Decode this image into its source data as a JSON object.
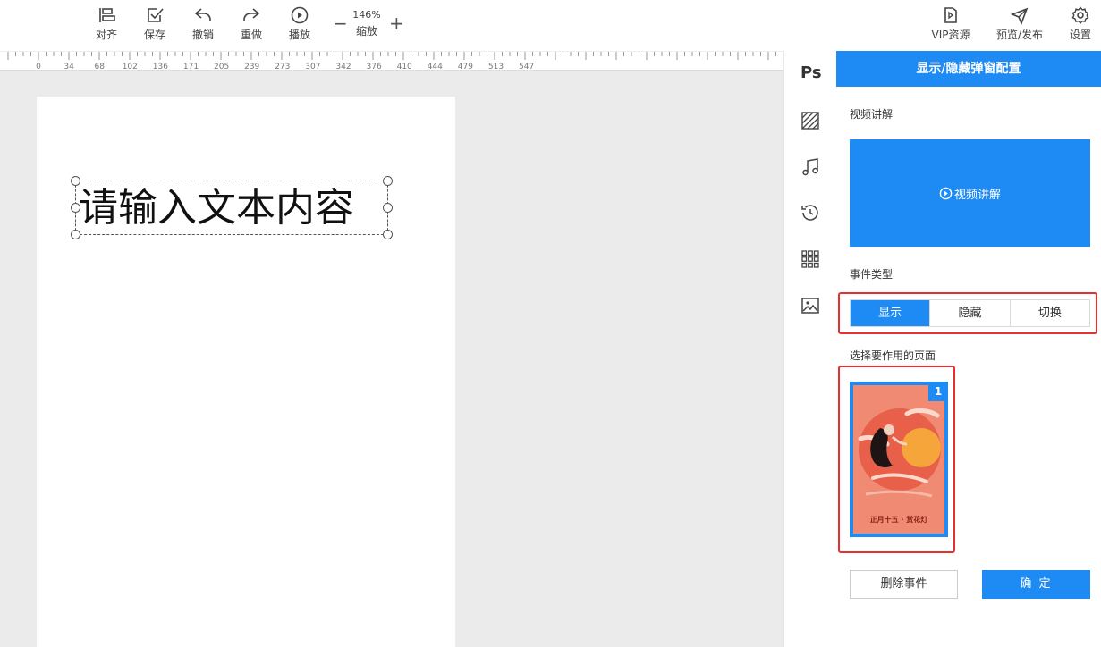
{
  "toolbar": {
    "align": "对齐",
    "save": "保存",
    "undo": "撤销",
    "redo": "重做",
    "play": "播放",
    "zoom_value": "146%",
    "zoom_label": "缩放",
    "zoom_minus": "−",
    "zoom_plus": "+",
    "vip": "VIP资源",
    "preview_publish": "预览/发布",
    "settings": "设置"
  },
  "ruler": {
    "ticks": [
      "0",
      "34",
      "68",
      "102",
      "136",
      "171",
      "205",
      "239",
      "273",
      "307",
      "342",
      "376",
      "410",
      "444",
      "479",
      "513",
      "547"
    ]
  },
  "canvas": {
    "text": "请输入文本内容"
  },
  "sidebar": {
    "ps": "Ps",
    "icons": [
      "texture-icon",
      "music-icon",
      "history-icon",
      "grid-icon",
      "image-icon"
    ]
  },
  "panel": {
    "title": "显示/隐藏弹窗配置",
    "video_section": "视频讲解",
    "video_button": "视频讲解",
    "event_type": "事件类型",
    "segments": [
      "显示",
      "隐藏",
      "切换"
    ],
    "select_page": "选择要作用的页面",
    "page_number": "1",
    "thumb_caption": "正月十五 · 赏花灯",
    "delete_button": "删除事件",
    "ok_button": "确 定"
  },
  "colors": {
    "accent": "#1e8bf5",
    "highlight": "#e53030"
  }
}
